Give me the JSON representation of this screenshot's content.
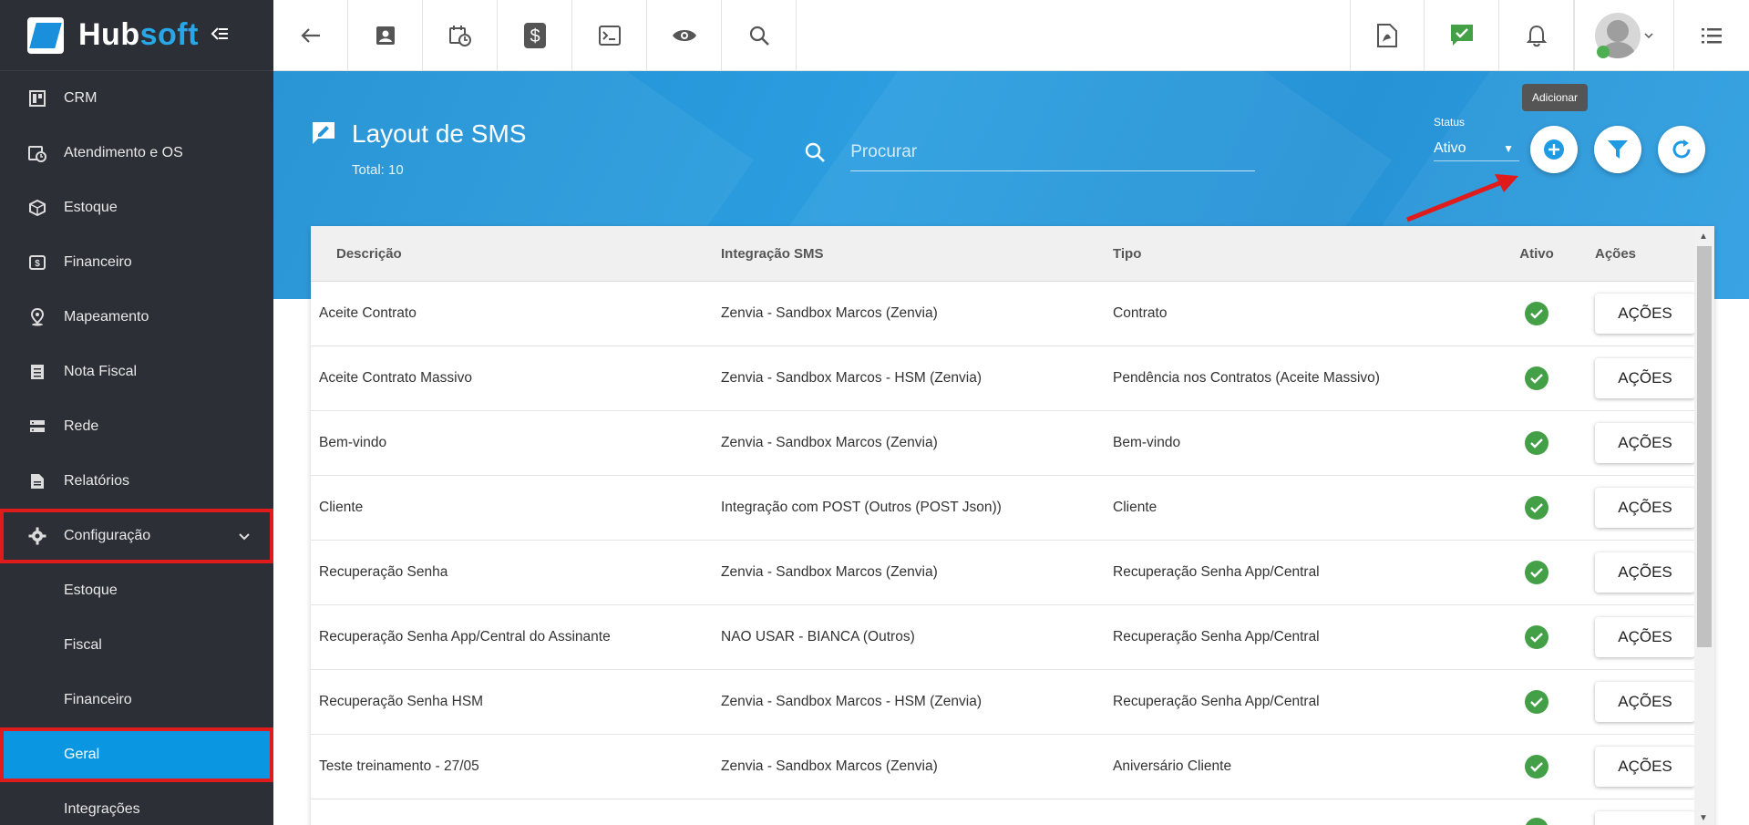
{
  "brand": {
    "name_part1": "Hub",
    "name_part2": "soft",
    "collapse_icon": "collapse-menu-icon"
  },
  "sidebar": {
    "items": [
      {
        "label": "CRM",
        "icon": "crm-board-icon"
      },
      {
        "label": "Atendimento e OS",
        "icon": "calendar-clock-icon"
      },
      {
        "label": "Estoque",
        "icon": "box-icon"
      },
      {
        "label": "Financeiro",
        "icon": "dollar-icon"
      },
      {
        "label": "Mapeamento",
        "icon": "map-pin-icon"
      },
      {
        "label": "Nota Fiscal",
        "icon": "invoice-icon"
      },
      {
        "label": "Rede",
        "icon": "server-icon"
      },
      {
        "label": "Relatórios",
        "icon": "report-icon"
      },
      {
        "label": "Configuração",
        "icon": "gear-icon"
      }
    ],
    "subitems": [
      {
        "label": "Estoque"
      },
      {
        "label": "Fiscal"
      },
      {
        "label": "Financeiro"
      },
      {
        "label": "Geral"
      },
      {
        "label": "Integrações"
      }
    ]
  },
  "topbar": {
    "icons": [
      "back-arrow-icon",
      "contact-card-icon",
      "calendar-clock-icon",
      "dollar-icon",
      "terminal-icon",
      "eye-icon",
      "search-icon"
    ],
    "right_icons": [
      "pdf-icon",
      "chat-check-icon",
      "bell-icon",
      "avatar",
      "list-menu-icon"
    ]
  },
  "header": {
    "title": "Layout de SMS",
    "total": "Total: 10",
    "search_placeholder": "Procurar",
    "status_label": "Status",
    "status_value": "Ativo",
    "tooltip": "Adicionar"
  },
  "table": {
    "columns": [
      "Descrição",
      "Integração SMS",
      "Tipo",
      "Ativo",
      "Ações"
    ],
    "action_label": "AÇÕES",
    "rows": [
      {
        "descricao": "Aceite Contrato",
        "integracao": "Zenvia - Sandbox Marcos (Zenvia)",
        "tipo": "Contrato",
        "ativo": true
      },
      {
        "descricao": "Aceite Contrato Massivo",
        "integracao": "Zenvia - Sandbox Marcos - HSM (Zenvia)",
        "tipo": "Pendência nos Contratos (Aceite Massivo)",
        "ativo": true
      },
      {
        "descricao": "Bem-vindo",
        "integracao": "Zenvia - Sandbox Marcos (Zenvia)",
        "tipo": "Bem-vindo",
        "ativo": true
      },
      {
        "descricao": "Cliente",
        "integracao": "Integração com POST (Outros (POST Json))",
        "tipo": "Cliente",
        "ativo": true
      },
      {
        "descricao": "Recuperação Senha",
        "integracao": "Zenvia - Sandbox Marcos (Zenvia)",
        "tipo": "Recuperação Senha App/Central",
        "ativo": true
      },
      {
        "descricao": "Recuperação Senha App/Central do Assinante",
        "integracao": "NAO USAR - BIANCA (Outros)",
        "tipo": "Recuperação Senha App/Central",
        "ativo": true
      },
      {
        "descricao": "Recuperação Senha HSM",
        "integracao": "Zenvia - Sandbox Marcos - HSM (Zenvia)",
        "tipo": "Recuperação Senha App/Central",
        "ativo": true
      },
      {
        "descricao": "Teste treinamento - 27/05",
        "integracao": "Zenvia - Sandbox Marcos (Zenvia)",
        "tipo": "Aniversário Cliente",
        "ativo": true
      }
    ]
  },
  "colors": {
    "sidebar_bg": "#2c2f36",
    "accent_blue": "#0b96e2",
    "header_blue": "#2596d9",
    "highlight_red": "#e01b1b",
    "check_green": "#43a047"
  }
}
